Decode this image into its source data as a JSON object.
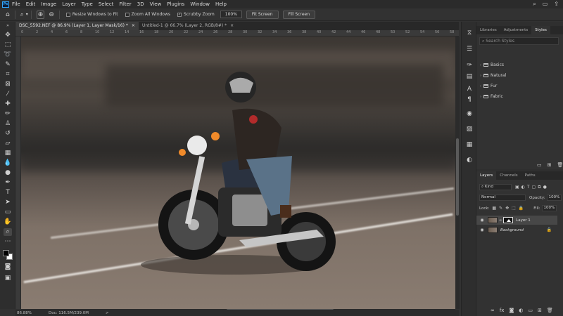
{
  "app": {
    "logo": "Ps"
  },
  "menu": [
    "File",
    "Edit",
    "Image",
    "Layer",
    "Type",
    "Select",
    "Filter",
    "3D",
    "View",
    "Plugins",
    "Window",
    "Help"
  ],
  "menu_right_icons": [
    "search-icon",
    "workspace-icon",
    "share-icon"
  ],
  "options_bar": {
    "zoom_percent_caret": "▾",
    "resize_windows": "Resize Windows to Fit",
    "zoom_all": "Zoom All Windows",
    "scrubby_zoom": "Scrubby Zoom",
    "zoom_value": "100%",
    "fit_screen": "Fit Screen",
    "fill_screen": "Fill Screen"
  },
  "tabs": [
    {
      "title": "DSC_5592.NEF @ 86.9% (Layer 1, Layer Mask/16) *",
      "close": "×",
      "active": true
    },
    {
      "title": "Untitled-1 @ 66.7% (Layer 2, RGB/8#) *",
      "close": "×",
      "active": false
    }
  ],
  "ruler_ticks": [
    "0",
    "2",
    "4",
    "6",
    "8",
    "10",
    "12",
    "14",
    "16",
    "18",
    "20",
    "22",
    "24",
    "26",
    "28",
    "30",
    "32",
    "34",
    "36",
    "38",
    "40",
    "42",
    "44",
    "46",
    "48",
    "50",
    "52",
    "54",
    "56",
    "58"
  ],
  "status": {
    "zoom": "86.88%",
    "doc": "Doc: 116.5M/239.0M",
    "arrow": ">"
  },
  "top_panel": {
    "tabs": [
      "Libraries",
      "Adjustments",
      "Styles"
    ],
    "active_tab": "Styles",
    "search_placeholder": "Search Styles",
    "folders": [
      "Basics",
      "Natural",
      "Fur",
      "Fabric"
    ]
  },
  "layers_panel": {
    "tabs": [
      "Layers",
      "Channels",
      "Paths"
    ],
    "active_tab": "Layers",
    "filter_kind": "Kind",
    "blend_mode": "Normal",
    "opacity_label": "Opacity:",
    "opacity_value": "100%",
    "lock_label": "Lock:",
    "fill_label": "Fill:",
    "fill_value": "100%",
    "layers": [
      {
        "name": "Layer 1",
        "selected": true,
        "has_mask": true
      },
      {
        "name": "Background",
        "selected": false,
        "has_mask": false,
        "locked": true
      }
    ],
    "footer_icons": [
      "link-icon",
      "fx-icon",
      "mask-icon",
      "adjustment-icon",
      "group-icon",
      "new-layer-icon",
      "trash-icon"
    ]
  },
  "colors": {
    "accent": "#31a8ff",
    "foreground": "#000000",
    "background": "#ffffff"
  }
}
